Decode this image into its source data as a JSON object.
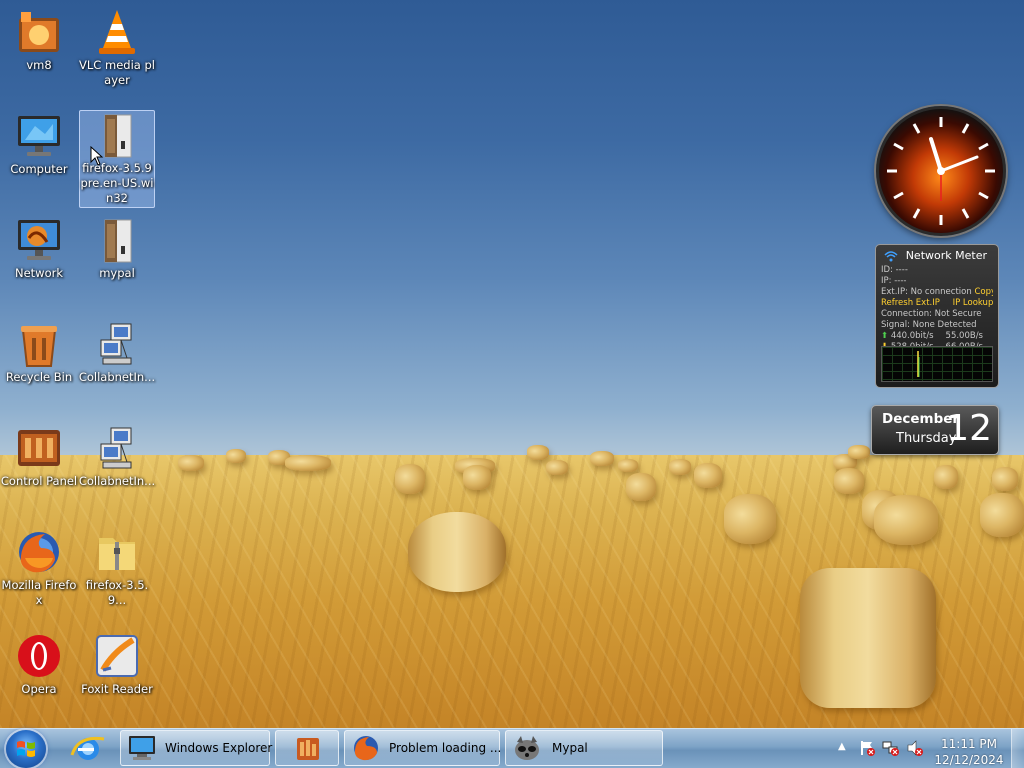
{
  "desktop": {
    "icons": [
      {
        "label": "vm8"
      },
      {
        "label": "VLC media player"
      },
      {
        "label": "Computer"
      },
      {
        "label": "firefox-3.5.9pre.en-US.win32"
      },
      {
        "label": "Network"
      },
      {
        "label": "mypal"
      },
      {
        "label": "Recycle Bin"
      },
      {
        "label": "CollabnetIn..."
      },
      {
        "label": "Control Panel"
      },
      {
        "label": "CollabnetIn..."
      },
      {
        "label": "Mozilla Firefox"
      },
      {
        "label": "firefox-3.5.9..."
      },
      {
        "label": "Opera"
      },
      {
        "label": "Foxit Reader"
      }
    ]
  },
  "gadgets": {
    "network_meter": {
      "title": "Network Meter",
      "id_line": "ID: ----",
      "ip_line": "IP: ----",
      "ext_ip_line": "Ext.IP: No connection",
      "copy": "Copy",
      "refresh": "Refresh Ext.IP",
      "lookup": "IP Lookup",
      "connection_line": "Connection: Not Secure",
      "signal_line": "Signal:  None Detected",
      "up_bits": "440.0bit/s",
      "up_bytes": "55.00B/s",
      "down_bits": "528.0bit/s",
      "down_bytes": "66.00B/s"
    },
    "calendar": {
      "month": "December",
      "weekday": "Thursday",
      "day": "12"
    }
  },
  "taskbar": {
    "tasks": [
      {
        "label": "Windows Explorer"
      },
      {
        "label": "Problem loading ..."
      },
      {
        "label": "Mypal"
      }
    ],
    "tray": {
      "time": "11:11 PM",
      "date": "12/12/2024"
    }
  }
}
